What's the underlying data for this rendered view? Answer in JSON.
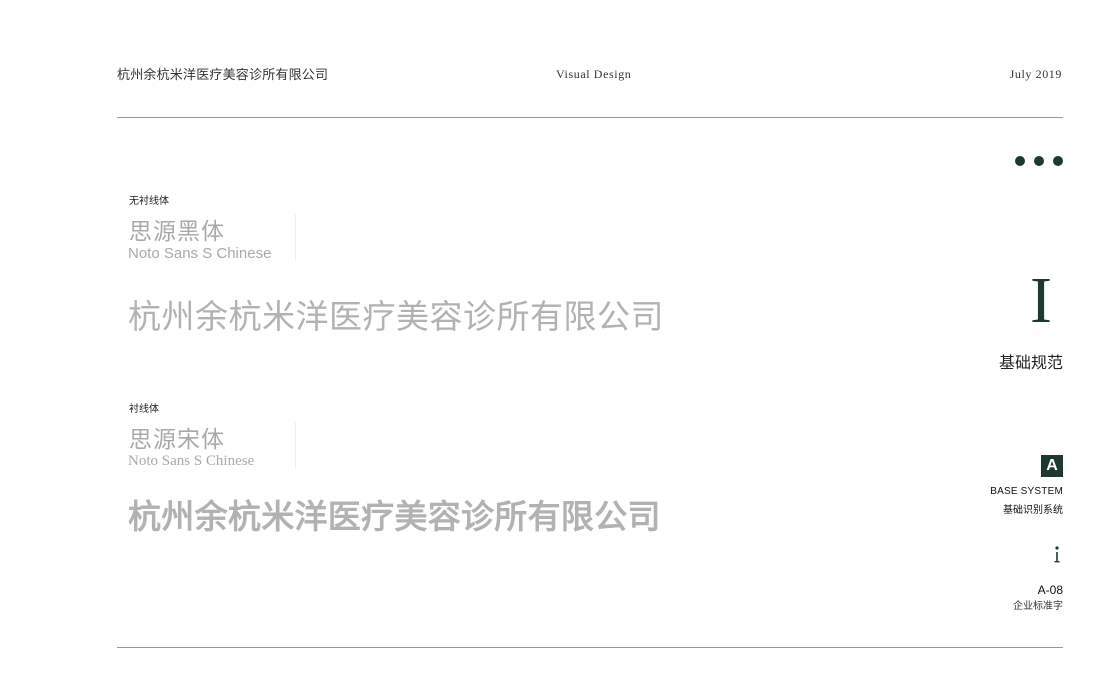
{
  "header": {
    "company": "杭州余杭米洋医疗美容诊所有限公司",
    "center": "Visual Design",
    "date": "July 2019"
  },
  "samples": [
    {
      "category": "无衬线体",
      "font_cn": "思源黑体",
      "font_en": "Noto Sans S Chinese",
      "text": "杭州余杭米洋医疗美容诊所有限公司"
    },
    {
      "category": "衬线体",
      "font_cn": "思源宋体",
      "font_en": "Noto Sans S Chinese",
      "text": "杭州余杭米洋医疗美容诊所有限公司"
    }
  ],
  "side": {
    "roman": "I",
    "section_title": "基础规范",
    "badge_letter": "A",
    "base_en": "BASE SYSTEM",
    "base_cn": "基础识别系统",
    "info_icon": "info-icon",
    "page_number": "A-08",
    "page_title": "企业标准字"
  },
  "colors": {
    "accent": "#1d3a2d",
    "sample_gray": "#b2b2b2",
    "rule": "#9a9a9a"
  }
}
